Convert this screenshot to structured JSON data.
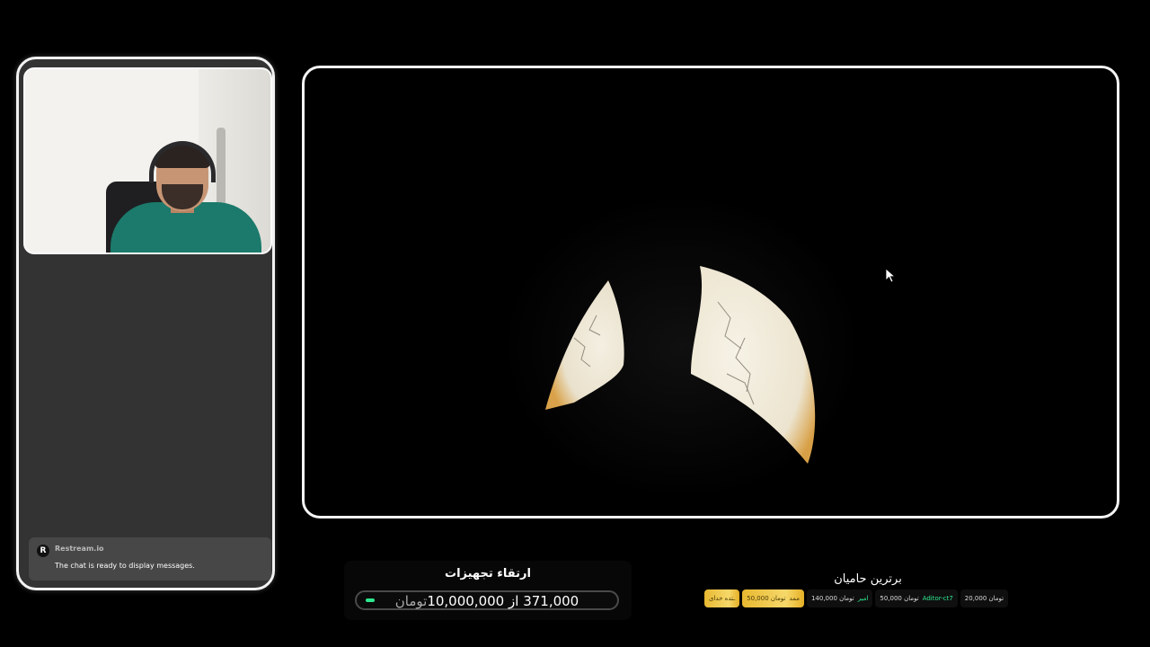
{
  "chat": {
    "sender": "Restream.io",
    "logo_letter": "R",
    "message": "The chat is ready to display messages."
  },
  "equipment_goal": {
    "title": "ارتقاء تجهیزات",
    "current": "371,000",
    "separator": "از",
    "target": "10,000,000",
    "unit": "تومان",
    "progress_fraction": 0.0371
  },
  "top_sponsors": {
    "title": "برترین حامیان",
    "items": [
      {
        "amount": "ـتده خدای",
        "name": "",
        "highlight": true
      },
      {
        "amount": "50,000 تومان",
        "name": "ممد",
        "highlight": true
      },
      {
        "amount": "140,000 تومان",
        "name": "امیر",
        "highlight": false
      },
      {
        "amount": "50,000 تومان",
        "name": "Aditor-ct7",
        "highlight": false
      },
      {
        "amount": "20,000 تومان",
        "name": "",
        "highlight": false
      }
    ]
  },
  "colors": {
    "panel_bg": "#333334",
    "accent_green": "#2ee88e",
    "gold": "#f0c74a"
  }
}
